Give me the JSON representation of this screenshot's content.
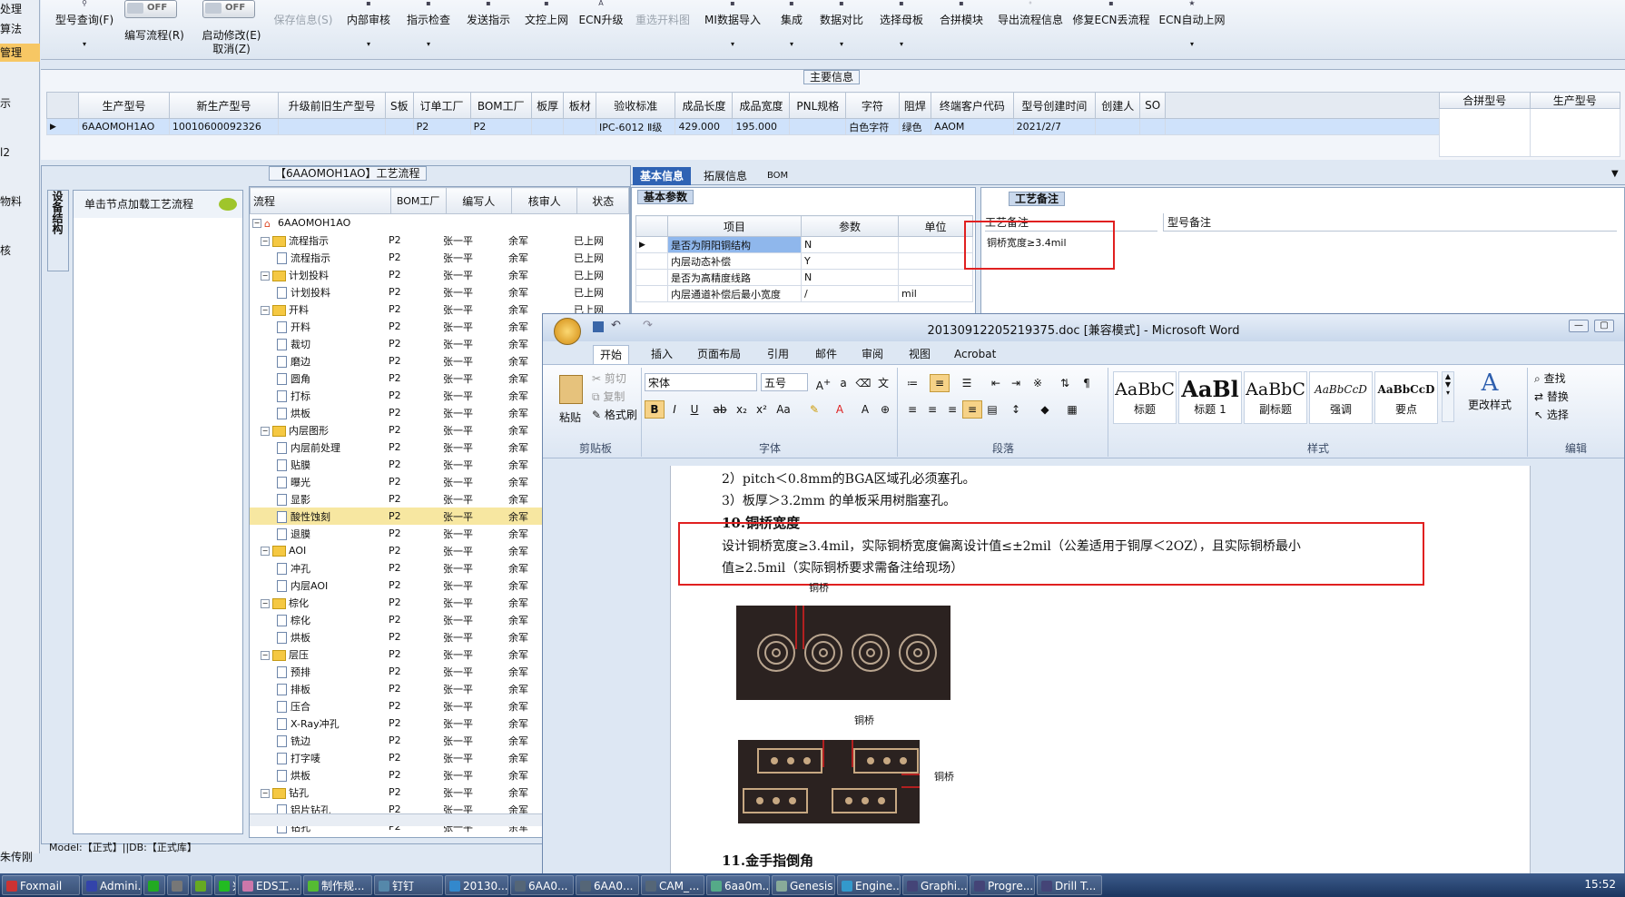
{
  "rail": {
    "items": [
      "处理",
      "算法",
      "管理",
      "示",
      "l2",
      "物料",
      "核"
    ],
    "status": "朱传刚"
  },
  "toolbar": {
    "toggle_off": "OFF",
    "buttons": [
      {
        "l1": "型号查询(F)",
        "arrow": "▾"
      },
      {
        "l1": "编写流程(R)"
      },
      {
        "l1": "启动修改(E)",
        "l2": "取消(Z)"
      },
      {
        "l1": "保存信息(S)"
      },
      {
        "l1": "内部审核",
        "arrow": "▾"
      },
      {
        "l1": "指示检查",
        "arrow": "▾"
      },
      {
        "l1": "发送指示"
      },
      {
        "l1": "文控上网"
      },
      {
        "l1": "ECN升级"
      },
      {
        "l1": "重选开料图"
      },
      {
        "l1": "MI数据导入",
        "arrow": "▾"
      },
      {
        "l1": "集成",
        "arrow": "▾"
      },
      {
        "l1": "数据对比",
        "arrow": "▾"
      },
      {
        "l1": "选择母板",
        "arrow": "▾"
      },
      {
        "l1": "合拼模块"
      },
      {
        "l1": "导出流程信息"
      },
      {
        "l1": "修复ECN丢流程"
      },
      {
        "l1": "ECN自动上网",
        "arrow": "▾"
      }
    ]
  },
  "main_info": {
    "title": "主要信息",
    "columns": [
      "生产型号",
      "新生产型号",
      "升级前旧生产型号",
      "S板",
      "订单工厂",
      "BOM工厂",
      "板厚",
      "板材",
      "验收标准",
      "成品长度",
      "成品宽度",
      "PNL规格",
      "字符",
      "阻焊",
      "终端客户代码",
      "型号创建时间",
      "创建人",
      "SO"
    ],
    "row": [
      "6AAOMOH1AO",
      "10010600092326",
      "",
      "",
      "P2",
      "P2",
      "",
      "",
      "IPC-6012 Ⅱ级",
      "429.000",
      "195.000",
      "",
      "白色字符",
      "绿色",
      "AAOM",
      "2021/2/7",
      "",
      ""
    ],
    "right_columns": [
      "合拼型号",
      "生产型号"
    ]
  },
  "process": {
    "title": "【6AAOMOH1AO】工艺流程",
    "side_tab": "设备结构",
    "load_hint": "单击节点加载工艺流程",
    "columns": [
      "流程",
      "BOM工厂",
      "编写人",
      "核审人",
      "状态"
    ],
    "root": "6AAOMOH1AO",
    "rows": [
      {
        "name": "流程指示",
        "type": "folder"
      },
      {
        "name": "流程指示",
        "type": "doc"
      },
      {
        "name": "计划投料",
        "type": "folder"
      },
      {
        "name": "计划投料",
        "type": "doc"
      },
      {
        "name": "开料",
        "type": "folder"
      },
      {
        "name": "开料",
        "type": "doc"
      },
      {
        "name": "裁切",
        "type": "doc"
      },
      {
        "name": "磨边",
        "type": "doc"
      },
      {
        "name": "圆角",
        "type": "doc"
      },
      {
        "name": "打标",
        "type": "doc"
      },
      {
        "name": "烘板",
        "type": "doc"
      },
      {
        "name": "内层图形",
        "type": "folder"
      },
      {
        "name": "内层前处理",
        "type": "doc"
      },
      {
        "name": "贴膜",
        "type": "doc"
      },
      {
        "name": "曝光",
        "type": "doc"
      },
      {
        "name": "显影",
        "type": "doc"
      },
      {
        "name": "酸性蚀刻",
        "type": "doc",
        "sel": true
      },
      {
        "name": "退膜",
        "type": "doc"
      },
      {
        "name": "AOI",
        "type": "folder"
      },
      {
        "name": "冲孔",
        "type": "doc"
      },
      {
        "name": "内层AOI",
        "type": "doc"
      },
      {
        "name": "棕化",
        "type": "folder"
      },
      {
        "name": "棕化",
        "type": "doc"
      },
      {
        "name": "烘板",
        "type": "doc"
      },
      {
        "name": "层压",
        "type": "folder"
      },
      {
        "name": "预排",
        "type": "doc"
      },
      {
        "name": "排板",
        "type": "doc"
      },
      {
        "name": "压合",
        "type": "doc"
      },
      {
        "name": "X-Ray冲孔",
        "type": "doc"
      },
      {
        "name": "铣边",
        "type": "doc"
      },
      {
        "name": "打字唛",
        "type": "doc"
      },
      {
        "name": "烘板",
        "type": "doc"
      },
      {
        "name": "钻孔",
        "type": "folder"
      },
      {
        "name": "铝片钻孔",
        "type": "doc"
      },
      {
        "name": "钻孔",
        "type": "doc"
      }
    ],
    "factory": "P2",
    "writer": "张一平",
    "reviewer": "余军",
    "status": "已上网",
    "footer": "Model:【正式】||DB:【正式库】"
  },
  "info_tabs": {
    "tabs": [
      "基本信息",
      "拓展信息",
      "BOM"
    ]
  },
  "basic_params": {
    "title": "基本参数",
    "columns": [
      "项目",
      "参数",
      "单位"
    ],
    "rows": [
      [
        "是否为阴阳铜结构",
        "N",
        ""
      ],
      [
        "内层动态补偿",
        "Y",
        ""
      ],
      [
        "是否为高精度线路",
        "N",
        ""
      ],
      [
        "内层通道补偿后最小宽度",
        "/",
        "mil"
      ]
    ]
  },
  "craft_notes": {
    "title": "工艺备注",
    "col1": "工艺备注",
    "col2": "型号备注",
    "note": "铜桥宽度≥3.4mil"
  },
  "word": {
    "title": "20130912205219375.doc [兼容模式] - Microsoft Word",
    "tabs": [
      "开始",
      "插入",
      "页面布局",
      "引用",
      "邮件",
      "审阅",
      "视图",
      "Acrobat"
    ],
    "clipboard": {
      "paste": "粘贴",
      "cut": "剪切",
      "copy": "复制",
      "painter": "格式刷",
      "title": "剪贴板"
    },
    "font": {
      "name": "宋体",
      "size": "五号",
      "title": "字体"
    },
    "paragraph_title": "段落",
    "styles": [
      {
        "sample": "AaBbC",
        "name": "标题"
      },
      {
        "sample": "AaBl",
        "name": "标题 1"
      },
      {
        "sample": "AaBbC",
        "name": "副标题"
      },
      {
        "sample": "AaBbCcD",
        "name": "强调"
      },
      {
        "sample": "AaBbCcD",
        "name": "要点"
      }
    ],
    "styles_title": "样式",
    "change_styles": "更改样式",
    "editing": {
      "find": "查找",
      "replace": "替换",
      "select": "选择",
      "title": "编辑"
    },
    "doc": {
      "line1": "2）pitch＜0.8mm的BGA区域孔必须塞孔。",
      "line2": "3）板厚＞3.2mm 的单板采用树脂塞孔。",
      "heading10": "10.铜桥宽度",
      "para1": "设计铜桥宽度≥3.4mil，实际铜桥宽度偏离设计值≤±2mil（公差适用于铜厚＜2OZ），且实际铜桥最小",
      "para2": "值≥2.5mil（实际铜桥要求需备注给现场）",
      "fig_label": "铜桥",
      "heading11": "11.金手指倒角"
    }
  },
  "taskbar": {
    "items": [
      "Foxmail",
      "Admini...",
      "",
      "",
      "",
      "兴森快...",
      "EDS工...",
      "制作规...",
      "钉钉",
      "20130...",
      "6AA0...",
      "6AA0...",
      "CAM_...",
      "6aa0m...",
      "Genesis",
      "Engine...",
      "Graphi...",
      "Progre...",
      "Drill T..."
    ],
    "time": "15:52"
  },
  "colors": {
    "accent": "#2f63b4",
    "highlight": "#e02020",
    "selected_row": "#f7e7a1"
  }
}
